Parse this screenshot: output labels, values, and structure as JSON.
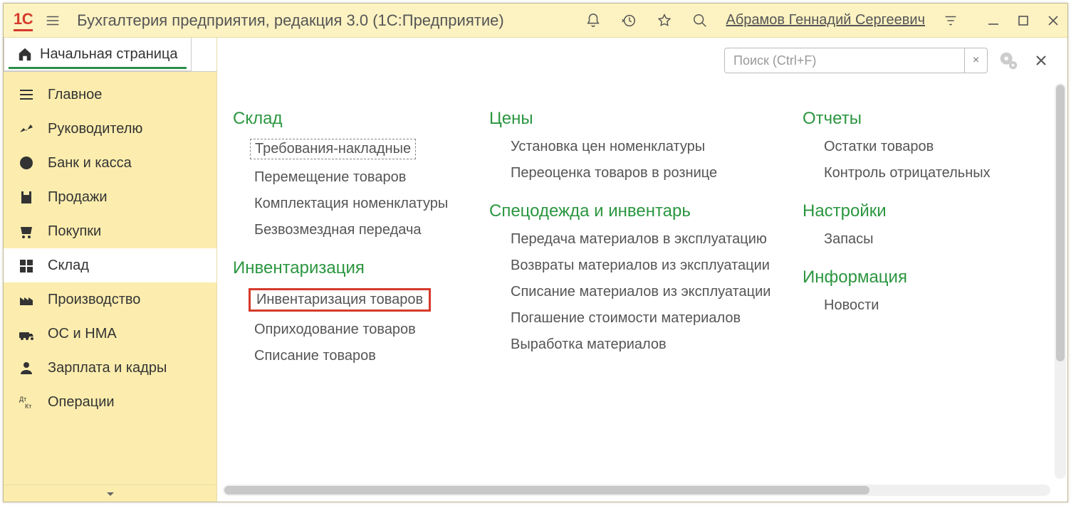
{
  "titlebar": {
    "app_title": "Бухгалтерия предприятия, редакция 3.0  (1С:Предприятие)",
    "user_name": "Абрамов Геннадий Сергеевич"
  },
  "tabs": {
    "home_label": "Начальная страница"
  },
  "sidebar": {
    "items": [
      {
        "label": "Главное"
      },
      {
        "label": "Руководителю"
      },
      {
        "label": "Банк и касса"
      },
      {
        "label": "Продажи"
      },
      {
        "label": "Покупки"
      },
      {
        "label": "Склад"
      },
      {
        "label": "Производство"
      },
      {
        "label": "ОС и НМА"
      },
      {
        "label": "Зарплата и кадры"
      },
      {
        "label": "Операции"
      }
    ]
  },
  "toolbar": {
    "search_placeholder": "Поиск (Ctrl+F)"
  },
  "sections": {
    "col0": [
      {
        "title": "Склад",
        "links": [
          {
            "label": "Требования-накладные",
            "style": "dashed"
          },
          {
            "label": "Перемещение товаров"
          },
          {
            "label": "Комплектация номенклатуры"
          },
          {
            "label": "Безвозмездная передача"
          }
        ]
      },
      {
        "title": "Инвентаризация",
        "links": [
          {
            "label": "Инвентаризация товаров",
            "style": "highlighted"
          },
          {
            "label": "Оприходование товаров"
          },
          {
            "label": "Списание товаров"
          }
        ]
      }
    ],
    "col1": [
      {
        "title": "Цены",
        "links": [
          {
            "label": "Установка цен номенклатуры"
          },
          {
            "label": "Переоценка товаров в рознице"
          }
        ]
      },
      {
        "title": "Спецодежда и инвентарь",
        "links": [
          {
            "label": "Передача материалов в эксплуатацию"
          },
          {
            "label": "Возвраты материалов из эксплуатации"
          },
          {
            "label": "Списание материалов из эксплуатации"
          },
          {
            "label": "Погашение стоимости материалов"
          },
          {
            "label": "Выработка материалов"
          }
        ]
      }
    ],
    "col2": [
      {
        "title": "Отчеты",
        "links": [
          {
            "label": "Остатки товаров"
          },
          {
            "label": "Контроль отрицательных"
          }
        ]
      },
      {
        "title": "Настройки",
        "links": [
          {
            "label": "Запасы"
          }
        ]
      },
      {
        "title": "Информация",
        "links": [
          {
            "label": "Новости"
          }
        ]
      }
    ]
  }
}
